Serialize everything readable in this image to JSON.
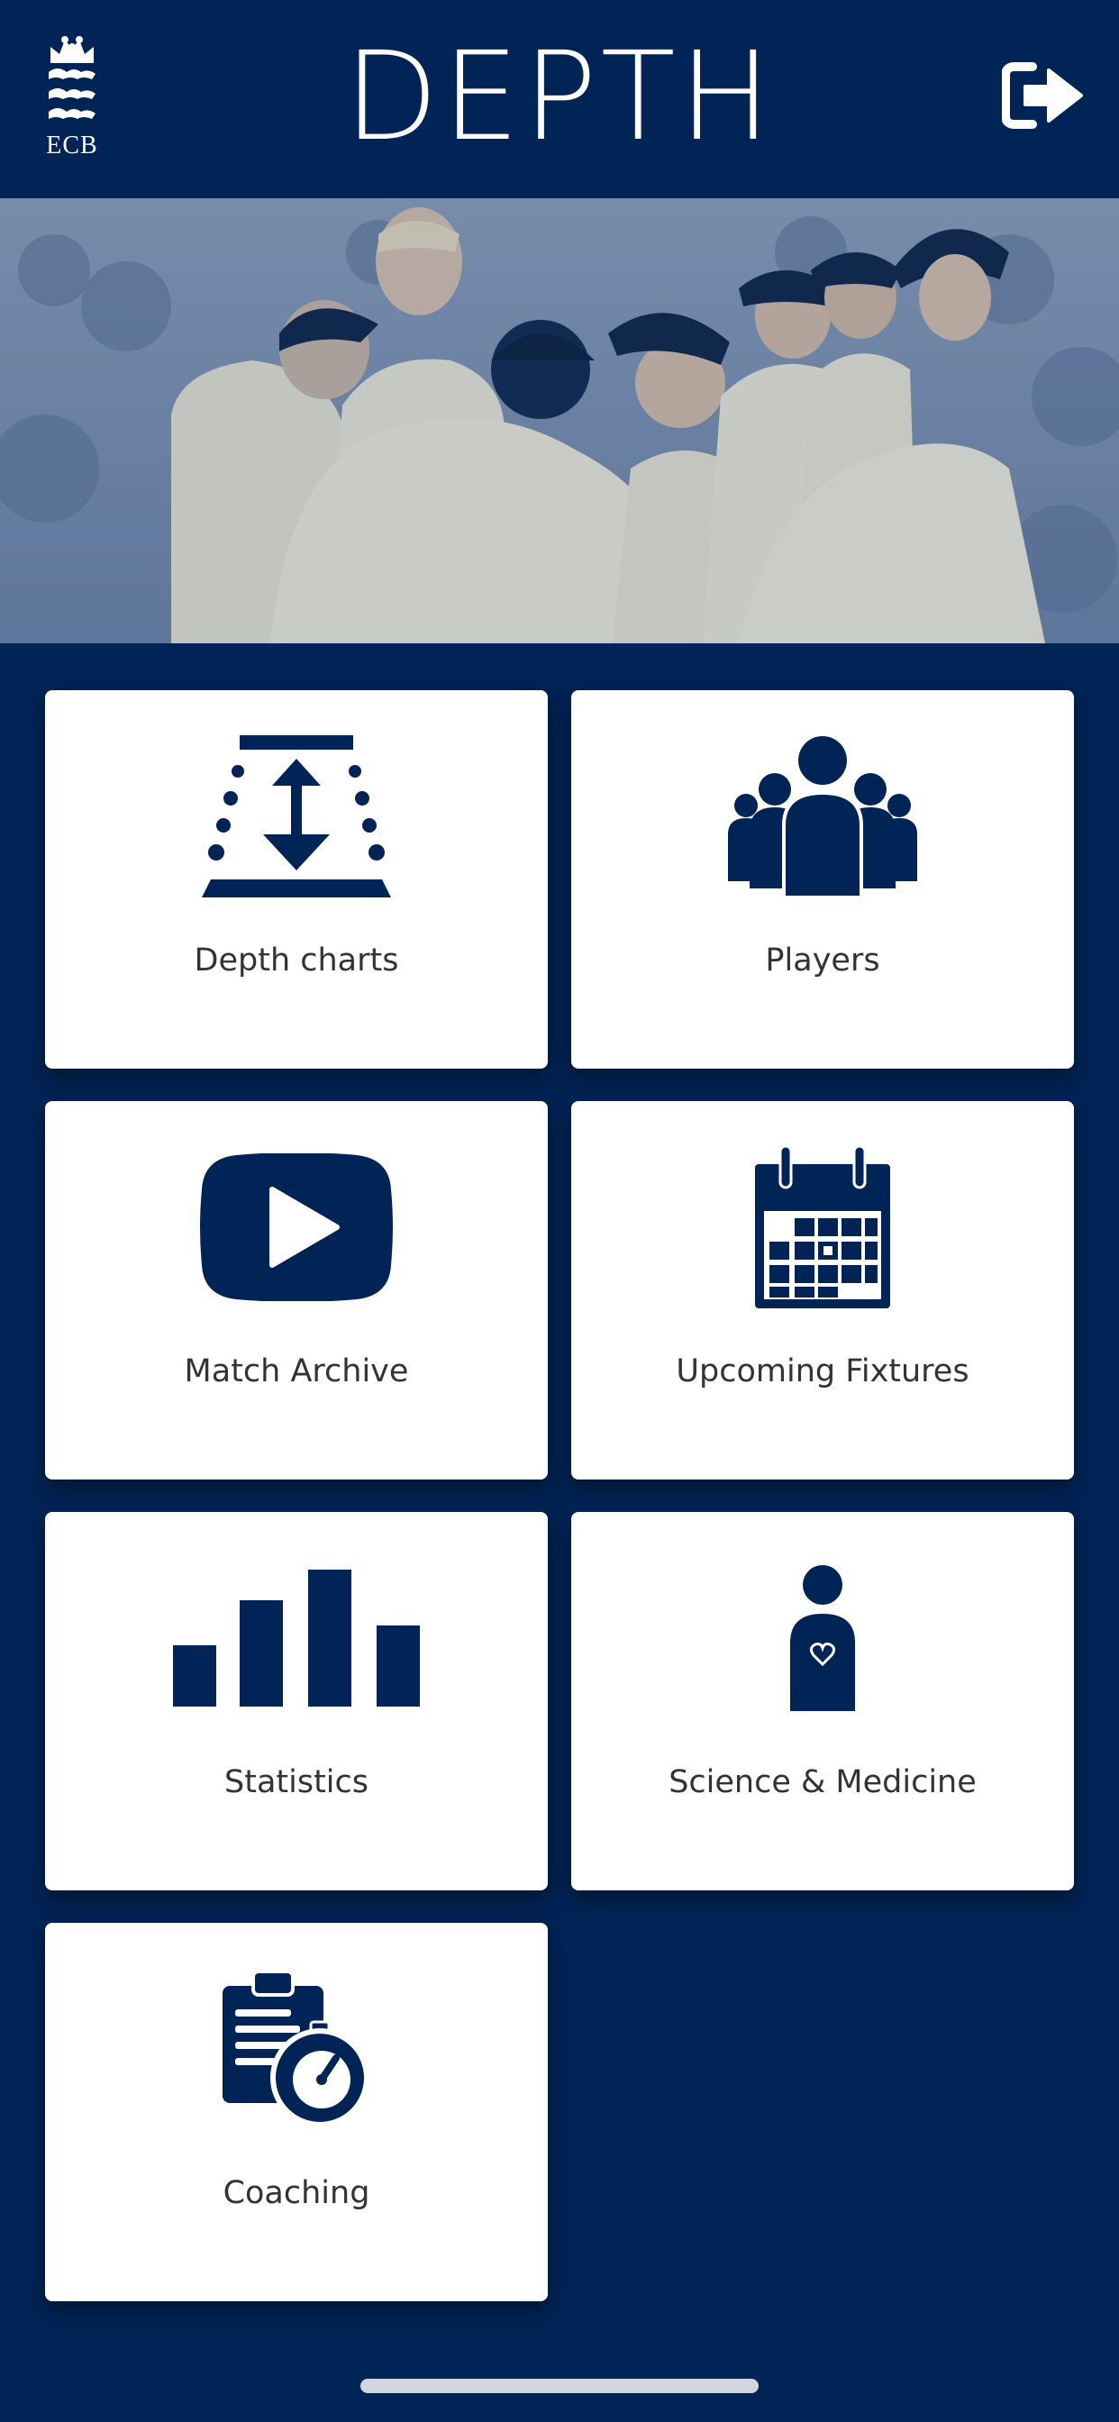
{
  "header": {
    "logo_text": "ECB",
    "title": "DEPTH",
    "logout_icon": "logout-icon"
  },
  "hero": {
    "image": "team-celebration-photo"
  },
  "tiles": [
    {
      "label": "Depth charts",
      "icon": "depth-chart-icon"
    },
    {
      "label": "Players",
      "icon": "players-icon"
    },
    {
      "label": "Match Archive",
      "icon": "play-video-icon"
    },
    {
      "label": "Upcoming Fixtures",
      "icon": "calendar-icon"
    },
    {
      "label": "Statistics",
      "icon": "bar-chart-icon"
    },
    {
      "label": "Science & Medicine",
      "icon": "person-heart-icon"
    },
    {
      "label": "Coaching",
      "icon": "clipboard-stopwatch-icon"
    }
  ],
  "colors": {
    "background": "#012456",
    "tile": "#ffffff",
    "icon": "#012456",
    "label": "#333333"
  }
}
